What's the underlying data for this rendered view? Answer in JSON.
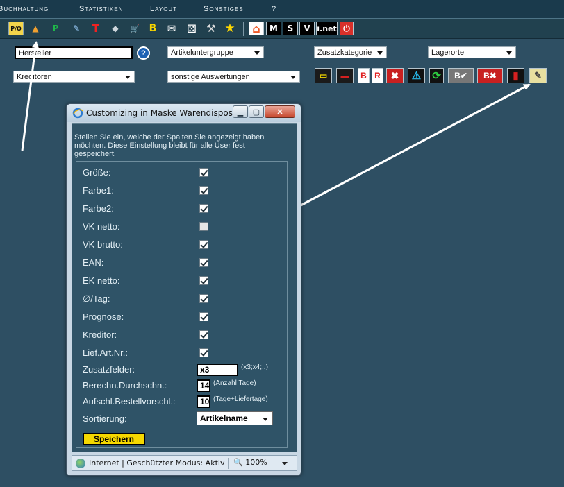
{
  "menu": [
    "Buchhaltung",
    "Statistiken",
    "Layout",
    "Sonstiges",
    "?"
  ],
  "toolbar": {
    "buttons": [
      {
        "name": "po-icon",
        "glyph": "P/O"
      },
      {
        "name": "boxes-icon",
        "glyph": "▲"
      },
      {
        "name": "p-icon",
        "glyph": "P"
      },
      {
        "name": "pen-icon",
        "glyph": "✎"
      },
      {
        "name": "t-icon",
        "glyph": "T"
      },
      {
        "name": "eraser-icon",
        "glyph": "◆"
      },
      {
        "name": "cart-icon",
        "glyph": "🛒"
      },
      {
        "name": "b-icon",
        "glyph": "B"
      },
      {
        "name": "mail-icon",
        "glyph": "✉"
      },
      {
        "name": "dice-icon",
        "glyph": "⚄"
      },
      {
        "name": "hammer-icon",
        "glyph": "⚒"
      },
      {
        "name": "star-icon",
        "glyph": "★"
      },
      {
        "name": "house-icon",
        "glyph": "⌂"
      },
      {
        "name": "m-icon",
        "glyph": "M"
      },
      {
        "name": "s-icon",
        "glyph": "S"
      },
      {
        "name": "v-icon",
        "glyph": "V"
      },
      {
        "name": "inet-icon",
        "glyph": "i.net"
      },
      {
        "name": "power-icon",
        "glyph": "⏻"
      }
    ]
  },
  "filters": {
    "hersteller": "Hersteller",
    "artikeluntergruppe": "Artikeluntergruppe",
    "zusatzkategorie": "Zusatzkategorie",
    "lagerorte": "Lagerorte",
    "kreditoren": "Kreditoren",
    "auswertungen": "sonstige Auswertungen",
    "help": "?"
  },
  "actions": [
    {
      "name": "machine-yellow-icon",
      "glyph": "▭"
    },
    {
      "name": "machine-red-icon",
      "glyph": "▬"
    },
    {
      "name": "b-red-icon",
      "glyph": "B"
    },
    {
      "name": "r-red-icon",
      "glyph": "R"
    },
    {
      "name": "delete-icon",
      "glyph": "✖"
    },
    {
      "name": "warning-icon",
      "glyph": "⚠"
    },
    {
      "name": "refresh-icon",
      "glyph": "⟳"
    },
    {
      "name": "b-check-icon",
      "glyph": "B✔"
    },
    {
      "name": "b-delete-icon",
      "glyph": "B✖"
    },
    {
      "name": "bucket-icon",
      "glyph": "▮"
    },
    {
      "name": "customize-icon",
      "glyph": "✎"
    }
  ],
  "dialog": {
    "title": "Customizing in Maske Warendispositi...",
    "intro": "Stellen Sie ein, welche der Spalten Sie angezeigt haben möchten. Diese Einstellung bleibt für alle User fest gespeichert.",
    "columns": [
      {
        "label": "Größe:",
        "checked": true
      },
      {
        "label": "Farbe1:",
        "checked": true
      },
      {
        "label": "Farbe2:",
        "checked": true
      },
      {
        "label": "VK netto:",
        "checked": false
      },
      {
        "label": "VK brutto:",
        "checked": true
      },
      {
        "label": "EAN:",
        "checked": true
      },
      {
        "label": "EK netto:",
        "checked": true
      },
      {
        "label": "∅/Tag:",
        "checked": true
      },
      {
        "label": "Prognose:",
        "checked": true
      },
      {
        "label": "Kreditor:",
        "checked": true
      },
      {
        "label": "Lief.Art.Nr.:",
        "checked": true
      }
    ],
    "zusatzfelder": {
      "label": "Zusatzfelder:",
      "value": "x3",
      "hint": "(x3;x4;..)"
    },
    "durchschn": {
      "label": "Berechn.Durchschn.:",
      "value": "14",
      "hint": "(Anzahl Tage)"
    },
    "bestellvorschl": {
      "label": "Aufschl.Bestellvorschl.:",
      "value": "10",
      "hint": "(Tage+Liefertage)"
    },
    "sortierung": {
      "label": "Sortierung:",
      "value": "Artikelname"
    },
    "save": "Speichern"
  },
  "status": {
    "text": "Internet | Geschützter Modus: Aktiv",
    "zoom": "100%"
  }
}
